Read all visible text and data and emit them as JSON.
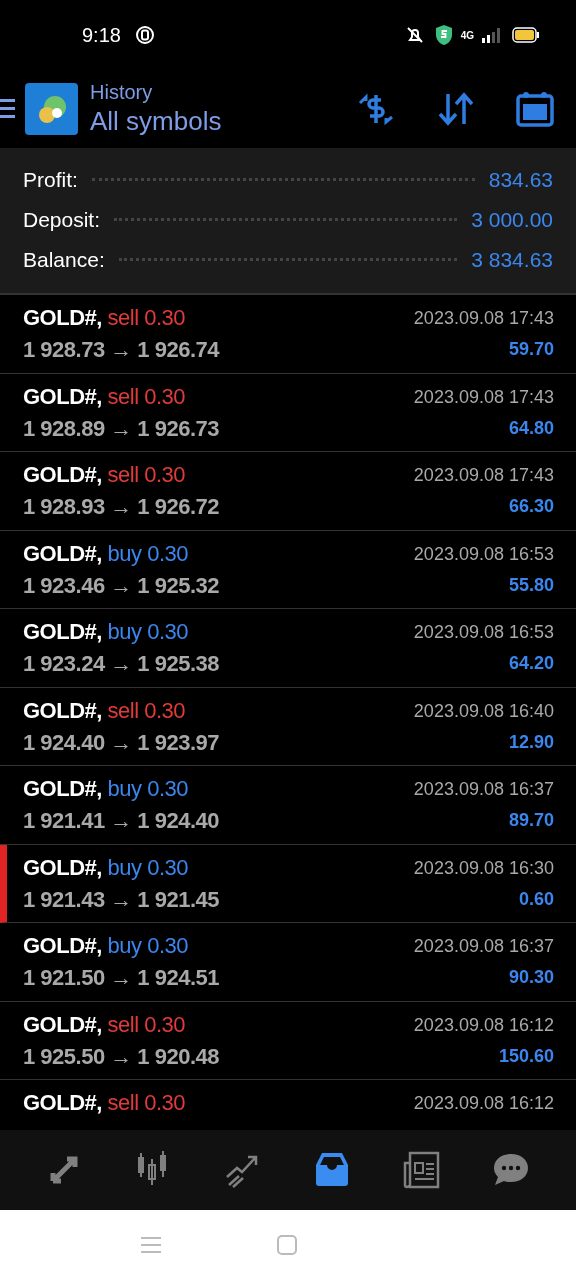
{
  "status_bar": {
    "time": "9:18",
    "network": "4G"
  },
  "header": {
    "title": "History",
    "subtitle": "All symbols"
  },
  "summary": [
    {
      "label": "Profit:",
      "value": "834.63"
    },
    {
      "label": "Deposit:",
      "value": "3 000.00"
    },
    {
      "label": "Balance:",
      "value": "3 834.63"
    }
  ],
  "deals": [
    {
      "symbol": "GOLD#,",
      "side": "sell",
      "volume": "0.30",
      "prices": "1 928.73 → 1 926.74",
      "time": "2023.09.08 17:43",
      "profit": "59.70",
      "marked": false
    },
    {
      "symbol": "GOLD#,",
      "side": "sell",
      "volume": "0.30",
      "prices": "1 928.89 → 1 926.73",
      "time": "2023.09.08 17:43",
      "profit": "64.80",
      "marked": false
    },
    {
      "symbol": "GOLD#,",
      "side": "sell",
      "volume": "0.30",
      "prices": "1 928.93 → 1 926.72",
      "time": "2023.09.08 17:43",
      "profit": "66.30",
      "marked": false
    },
    {
      "symbol": "GOLD#,",
      "side": "buy",
      "volume": "0.30",
      "prices": "1 923.46 → 1 925.32",
      "time": "2023.09.08 16:53",
      "profit": "55.80",
      "marked": false
    },
    {
      "symbol": "GOLD#,",
      "side": "buy",
      "volume": "0.30",
      "prices": "1 923.24 → 1 925.38",
      "time": "2023.09.08 16:53",
      "profit": "64.20",
      "marked": false
    },
    {
      "symbol": "GOLD#,",
      "side": "sell",
      "volume": "0.30",
      "prices": "1 924.40 → 1 923.97",
      "time": "2023.09.08 16:40",
      "profit": "12.90",
      "marked": false
    },
    {
      "symbol": "GOLD#,",
      "side": "buy",
      "volume": "0.30",
      "prices": "1 921.41 → 1 924.40",
      "time": "2023.09.08 16:37",
      "profit": "89.70",
      "marked": false
    },
    {
      "symbol": "GOLD#,",
      "side": "buy",
      "volume": "0.30",
      "prices": "1 921.43 → 1 921.45",
      "time": "2023.09.08 16:30",
      "profit": "0.60",
      "marked": true
    },
    {
      "symbol": "GOLD#,",
      "side": "buy",
      "volume": "0.30",
      "prices": "1 921.50 → 1 924.51",
      "time": "2023.09.08 16:37",
      "profit": "90.30",
      "marked": false
    },
    {
      "symbol": "GOLD#,",
      "side": "sell",
      "volume": "0.30",
      "prices": "1 925.50 → 1 920.48",
      "time": "2023.09.08 16:12",
      "profit": "150.60",
      "marked": false
    },
    {
      "symbol": "GOLD#,",
      "side": "sell",
      "volume": "0.30",
      "time": "2023.09.08 16:12",
      "marked": false
    }
  ],
  "bottom_nav": [
    {
      "kind": "quotes",
      "selected": false
    },
    {
      "kind": "chart",
      "selected": false
    },
    {
      "kind": "trade",
      "selected": false
    },
    {
      "kind": "history",
      "selected": true
    },
    {
      "kind": "news",
      "selected": false
    },
    {
      "kind": "chat",
      "selected": false
    }
  ]
}
